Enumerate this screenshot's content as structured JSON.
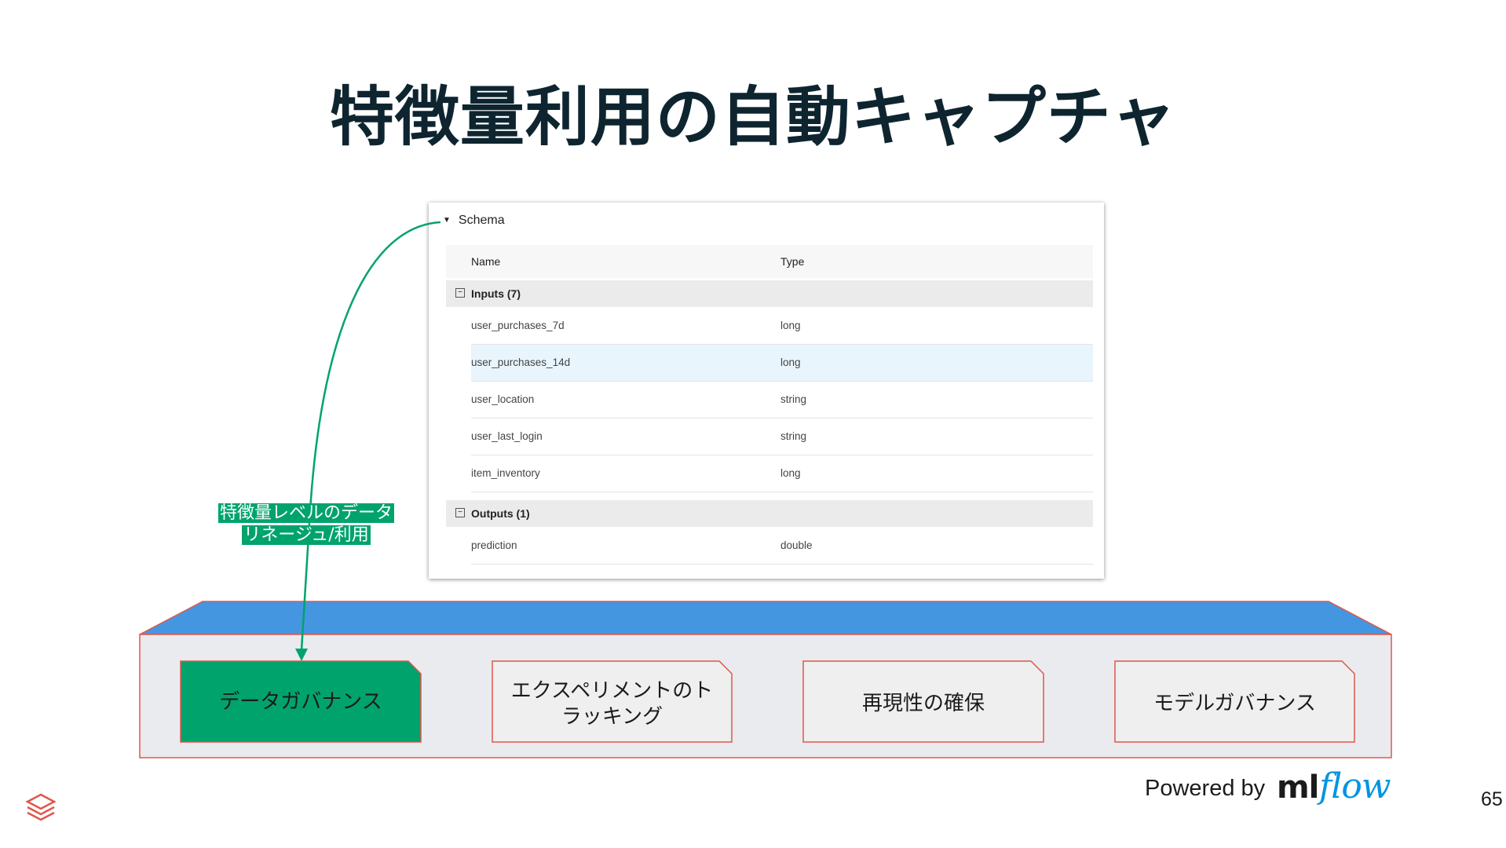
{
  "title": "特徴量利用の自動キャプチャ",
  "schema": {
    "heading": "Schema",
    "col_name": "Name",
    "col_type": "Type",
    "inputs_label": "Inputs (7)",
    "outputs_label": "Outputs (1)",
    "inputs": [
      {
        "name": "user_purchases_7d",
        "type": "long"
      },
      {
        "name": "user_purchases_14d",
        "type": "long"
      },
      {
        "name": "user_location",
        "type": "string"
      },
      {
        "name": "user_last_login",
        "type": "string"
      },
      {
        "name": "item_inventory",
        "type": "long"
      }
    ],
    "outputs": [
      {
        "name": "prediction",
        "type": "double"
      }
    ]
  },
  "annotation": {
    "line1": "特徴量レベルのデータ",
    "line2": "リネージュ/利用"
  },
  "cards": [
    {
      "line1": "データガバナンス",
      "line2": ""
    },
    {
      "line1": "エクスペリメントのト",
      "line2": "ラッキング"
    },
    {
      "line1": "再現性の確保",
      "line2": ""
    },
    {
      "line1": "モデルガバナンス",
      "line2": ""
    }
  ],
  "footer": {
    "powered_by": "Powered by",
    "brand_ml": "ml",
    "brand_flow": "flow",
    "page_number": "65"
  },
  "colors": {
    "accent_green": "#00a36c",
    "platform_top": "#4596e0",
    "platform_body": "#e9ebef",
    "card_border": "#e0564a",
    "mlflow_blue": "#0194e2"
  }
}
